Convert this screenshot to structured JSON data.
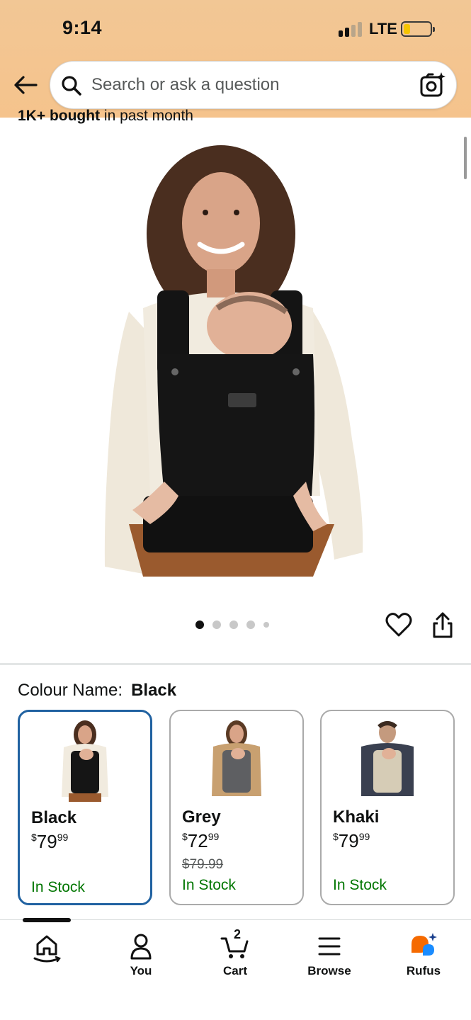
{
  "status_bar": {
    "time": "9:14",
    "network": "LTE"
  },
  "search": {
    "placeholder": "Search or ask a question"
  },
  "product": {
    "bought_bold": "1K+ bought",
    "bought_rest": " in past month",
    "image_count": 5,
    "active_image_index": 0
  },
  "variations": {
    "label": "Colour Name:",
    "selected_value": "Black",
    "options": [
      {
        "name": "Black",
        "price_symbol": "$",
        "price_whole": "79",
        "price_fraction": "99",
        "list_price": "",
        "stock": "In Stock",
        "selected": true
      },
      {
        "name": "Grey",
        "price_symbol": "$",
        "price_whole": "72",
        "price_fraction": "99",
        "list_price": "$79.99",
        "stock": "In Stock",
        "selected": false
      },
      {
        "name": "Khaki",
        "price_symbol": "$",
        "price_whole": "79",
        "price_fraction": "99",
        "list_price": "",
        "stock": "In Stock",
        "selected": false
      }
    ]
  },
  "bottom_nav": {
    "items": [
      {
        "label": "",
        "icon": "home-icon"
      },
      {
        "label": "You",
        "icon": "person-icon"
      },
      {
        "label": "Cart",
        "icon": "cart-icon",
        "count": "2"
      },
      {
        "label": "Browse",
        "icon": "menu-icon"
      },
      {
        "label": "Rufus",
        "icon": "rufus-icon"
      }
    ]
  },
  "colors": {
    "header_bg": "#f5c38c",
    "selected_border": "#2162a1",
    "in_stock": "#007600",
    "rufus_orange": "#f56a00",
    "rufus_blue": "#1a8cff"
  }
}
